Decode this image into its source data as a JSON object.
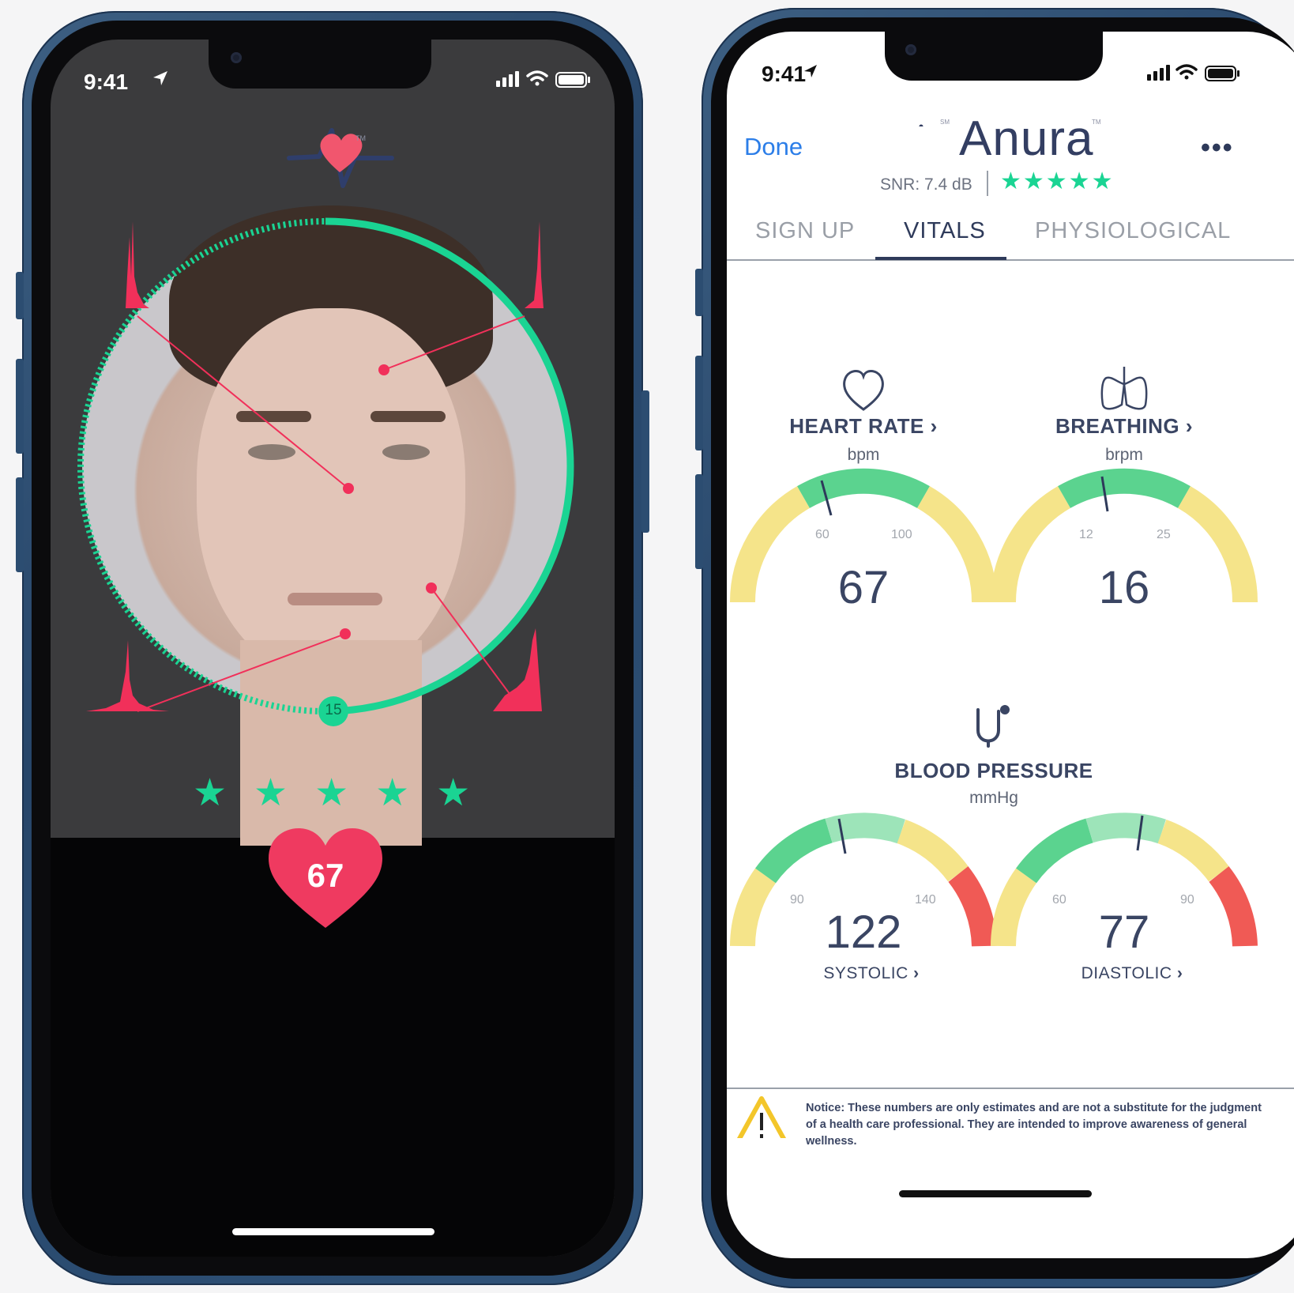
{
  "left_phone": {
    "status_time": "9:41",
    "countdown": "15",
    "stars": [
      "★",
      "★",
      "★",
      "★",
      "★"
    ],
    "heart_rate": "67",
    "logo_tm": "TM",
    "colors": {
      "accent_green": "#1ad493",
      "accent_red": "#f1305a",
      "heart": "#ef3a60"
    },
    "icons": [
      "location-arrow-icon",
      "signal-icon",
      "wifi-icon",
      "battery-icon",
      "anura-logo-icon",
      "heart-icon"
    ]
  },
  "right_phone": {
    "status_time": "9:41",
    "nav": {
      "done_label": "Done",
      "more_label": "•••"
    },
    "brand": {
      "name": "Anura",
      "tm": "TM",
      "sm": "SM"
    },
    "snr": {
      "label": "SNR: 7.4 dB",
      "stars": "★★★★★"
    },
    "tabs": [
      {
        "label": "SIGN UP",
        "active": false
      },
      {
        "label": "VITALS",
        "active": true
      },
      {
        "label": "PHYSIOLOGICAL",
        "active": false
      }
    ],
    "heart_rate": {
      "title": "HEART RATE",
      "unit": "bpm",
      "value": "67",
      "low": "60",
      "high": "100",
      "chevron": "›"
    },
    "breathing": {
      "title": "BREATHING",
      "unit": "brpm",
      "value": "16",
      "low": "12",
      "high": "25",
      "chevron": "›"
    },
    "blood_pressure": {
      "title": "BLOOD PRESSURE",
      "unit": "mmHg"
    },
    "systolic": {
      "value": "122",
      "label": "SYSTOLIC",
      "low": "90",
      "high": "140",
      "chevron": "›"
    },
    "diastolic": {
      "value": "77",
      "label": "DIASTOLIC",
      "low": "60",
      "high": "90",
      "chevron": "›"
    },
    "notice": "Notice: These numbers are only estimates and are not a substitute for the judgment of a health care professional. They are intended to improve awareness of general wellness.",
    "colors": {
      "gauge_yellow": "#f5e48a",
      "gauge_green": "#5bd38f",
      "gauge_light_green": "#9de4b9",
      "gauge_red": "#f05a55",
      "text_navy": "#3a4563",
      "link_blue": "#2c7ee8"
    }
  }
}
